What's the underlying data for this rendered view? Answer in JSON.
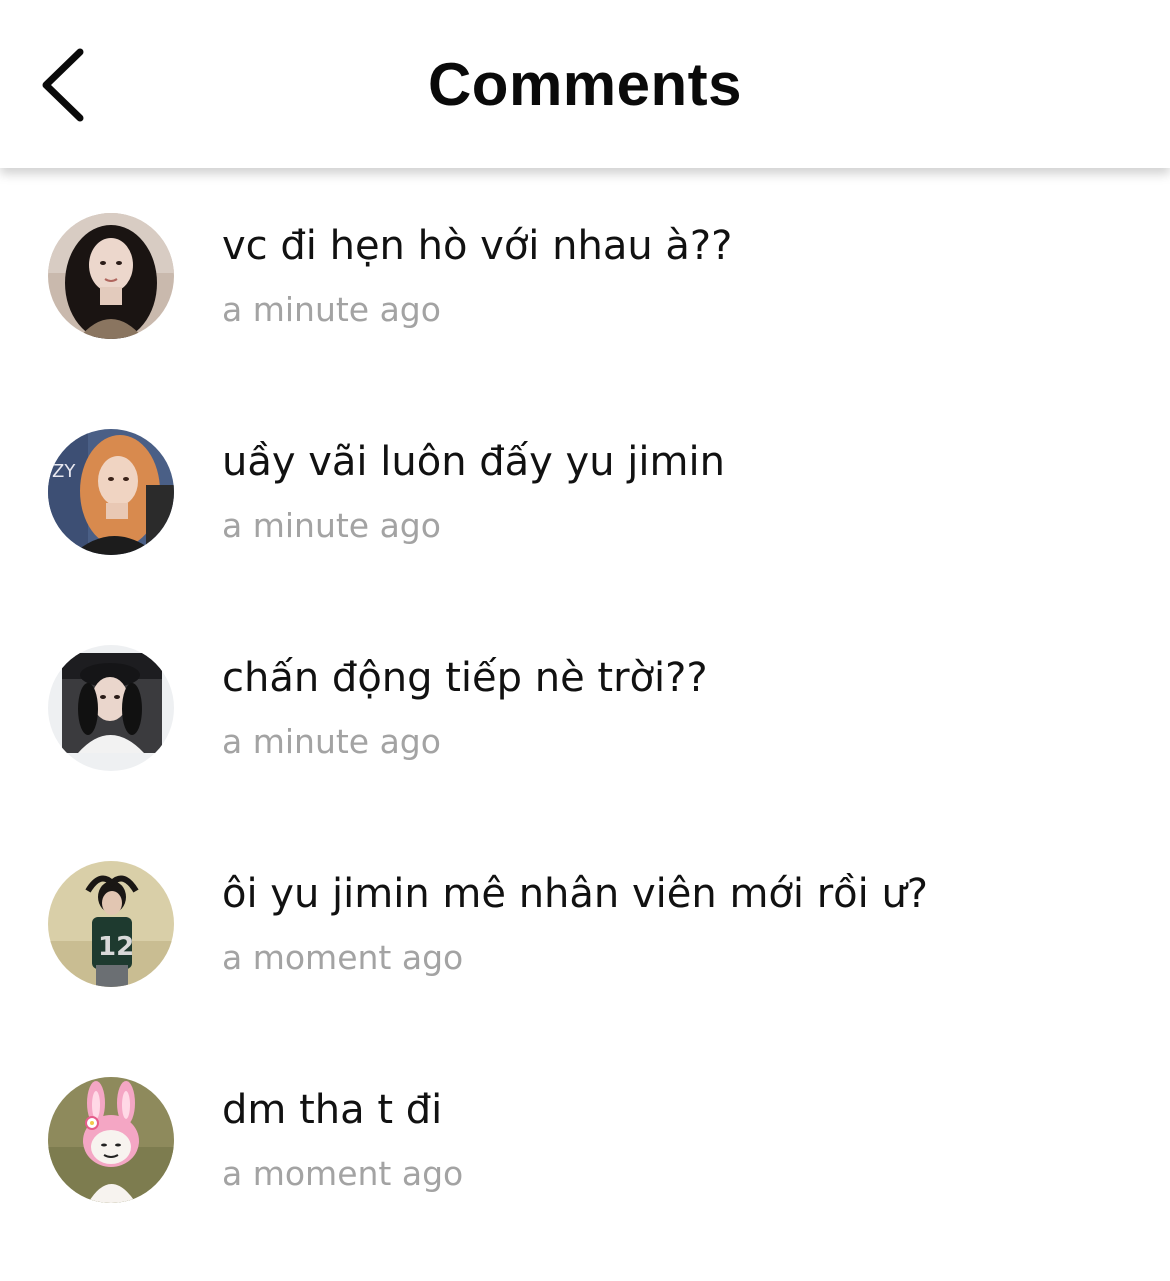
{
  "header": {
    "title": "Comments",
    "back_icon": "chevron-left-icon"
  },
  "comments": [
    {
      "text": "vc đi hẹn hò với nhau à??",
      "time": "a minute ago",
      "avatar": "avatar-photo-dark-hair"
    },
    {
      "text": "uầy vãi luôn đấy yu jimin",
      "time": "a minute ago",
      "avatar": "avatar-photo-orange-hair"
    },
    {
      "text": "chấn động tiếp nè trời??",
      "time": "a minute ago",
      "avatar": "avatar-photo-cap"
    },
    {
      "text": "ôi yu jimin mê nhân viên mới rồi ư?",
      "time": "a moment ago",
      "avatar": "avatar-photo-jersey-12"
    },
    {
      "text": "dm tha t đi",
      "time": "a moment ago",
      "avatar": "avatar-cartoon-bunny"
    }
  ],
  "colors": {
    "text": "#111111",
    "timestamp": "#a3a3a3",
    "background": "#ffffff"
  }
}
